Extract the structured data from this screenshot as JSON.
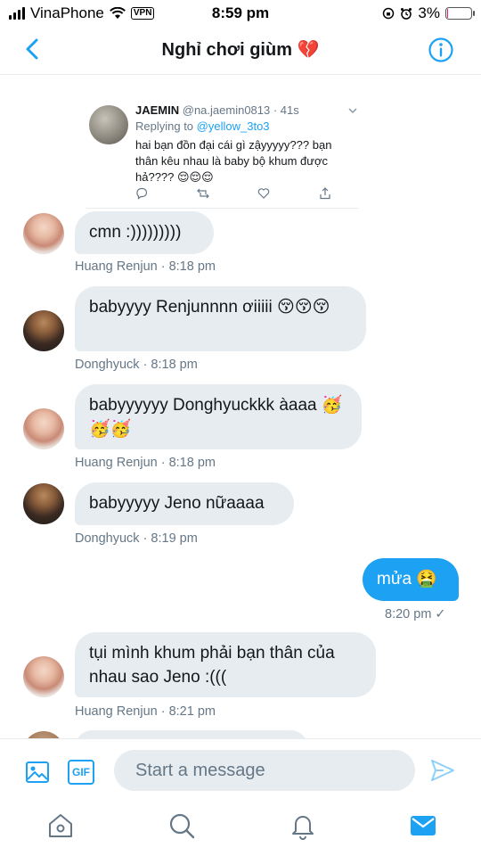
{
  "status_bar": {
    "carrier": "VinaPhone",
    "vpn": "VPN",
    "time": "8:59 pm",
    "battery": "3%",
    "battery_level": 0.03
  },
  "header": {
    "title": "Nghỉ chơi giùm 💔"
  },
  "tweet": {
    "name": "JAEMIN",
    "handle": "@na.jaemin0813 · 41s",
    "replying_prefix": "Replying to",
    "replying_handle": "@yellow_3to3",
    "text": "hai bạn đồn đại cái gì zậyyyyy??? bạn thân kêu nhau là baby bộ khum được hả???? 😌😌😌"
  },
  "messages": [
    {
      "sender": "Huang Renjun",
      "text": "cmn :)))))))))",
      "meta": "Huang Renjun · 8:18 pm"
    },
    {
      "sender": "Donghyuck",
      "text": "babyyyy Renjunnnn ơiiiii 😚😚😚",
      "meta": "Donghyuck · 8:18 pm"
    },
    {
      "sender": "Huang Renjun",
      "text": "babyyyyyy Donghyuckkk àaaa 🥳🥳🥳",
      "meta": "Huang Renjun · 8:18 pm"
    },
    {
      "sender": "Donghyuck",
      "text": "babyyyyy Jeno nữaaaa",
      "meta": "Donghyuck · 8:19 pm"
    },
    {
      "sender": "me",
      "text": "mửa 🤮",
      "meta": "8:20 pm ✓"
    },
    {
      "sender": "Huang Renjun",
      "text": "tụi mình khum phải bạn thân của nhau sao Jeno :(((",
      "meta": "Huang Renjun · 8:21 pm"
    }
  ],
  "composer": {
    "placeholder": "Start a message",
    "gif_label": "GIF"
  },
  "colors": {
    "accent": "#1da1f2",
    "bubble_gray": "#e6ecf0",
    "meta_gray": "#657786"
  },
  "icons": [
    "back-arrow-icon",
    "info-icon",
    "image-icon",
    "send-icon",
    "home-icon",
    "search-icon",
    "bell-icon",
    "mail-icon"
  ]
}
